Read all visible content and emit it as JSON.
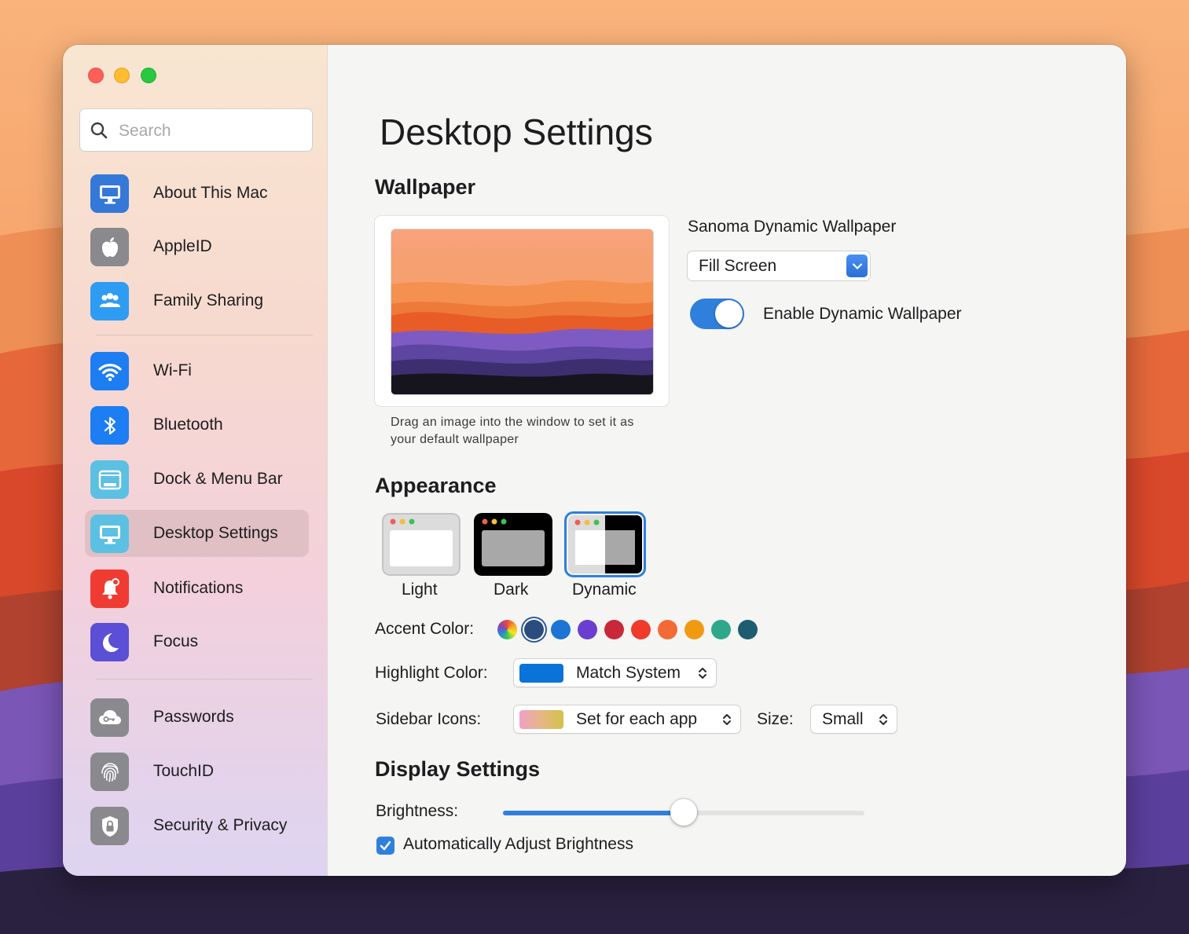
{
  "search": {
    "placeholder": "Search"
  },
  "sidebar": {
    "items": [
      {
        "label": "About This Mac",
        "icon": "display-icon",
        "color": "#3478d8"
      },
      {
        "label": "AppleID",
        "icon": "apple-icon",
        "color": "#8a8a8e"
      },
      {
        "label": "Family Sharing",
        "icon": "family-icon",
        "color": "#2e9cf2"
      },
      {
        "label": "Wi-Fi",
        "icon": "wifi-icon",
        "color": "#1d7df2"
      },
      {
        "label": "Bluetooth",
        "icon": "bluetooth-icon",
        "color": "#1d7df2"
      },
      {
        "label": "Dock & Menu Bar",
        "icon": "dock-icon",
        "color": "#5cc0e3"
      },
      {
        "label": "Desktop Settings",
        "icon": "desktop-icon",
        "color": "#5cc0e3",
        "selected": true
      },
      {
        "label": "Notifications",
        "icon": "bell-icon",
        "color": "#f03b32"
      },
      {
        "label": "Focus",
        "icon": "moon-icon",
        "color": "#5b4fd6"
      },
      {
        "label": "Passwords",
        "icon": "key-cloud-icon",
        "color": "#8a8a8e"
      },
      {
        "label": "TouchID",
        "icon": "fingerprint-icon",
        "color": "#8a8a8e"
      },
      {
        "label": "Security & Privacy",
        "icon": "lock-icon",
        "color": "#8a8a8e"
      }
    ]
  },
  "main": {
    "title": "Desktop Settings",
    "wallpaper": {
      "heading": "Wallpaper",
      "hint": "Drag an image into the window to set it as your default wallpaper",
      "name": "Sanoma Dynamic Wallpaper",
      "fit": "Fill Screen",
      "toggle_label": "Enable Dynamic Wallpaper",
      "toggle_on": true
    },
    "appearance": {
      "heading": "Appearance",
      "options": [
        {
          "label": "Light"
        },
        {
          "label": "Dark"
        },
        {
          "label": "Dynamic",
          "selected": true
        }
      ],
      "accent_label": "Accent Color:",
      "accent_colors": [
        "multicolor",
        "#2b4c7e",
        "#1c74d4",
        "#6a3fd0",
        "#c8283a",
        "#f03b2a",
        "#f36a35",
        "#f09a12",
        "#2fa88a",
        "#1e5c70"
      ],
      "accent_selected": 1,
      "highlight_label": "Highlight Color:",
      "highlight_value": "Match System",
      "highlight_color": "#0a73d9",
      "sidebar_icons_label": "Sidebar Icons:",
      "sidebar_icons_value": "Set for each app",
      "size_label": "Size:",
      "size_value": "Small"
    },
    "display": {
      "heading": "Display Settings",
      "brightness_label": "Brightness:",
      "brightness": 0.5,
      "auto_label": "Automatically Adjust Brightness",
      "auto_checked": true
    }
  }
}
